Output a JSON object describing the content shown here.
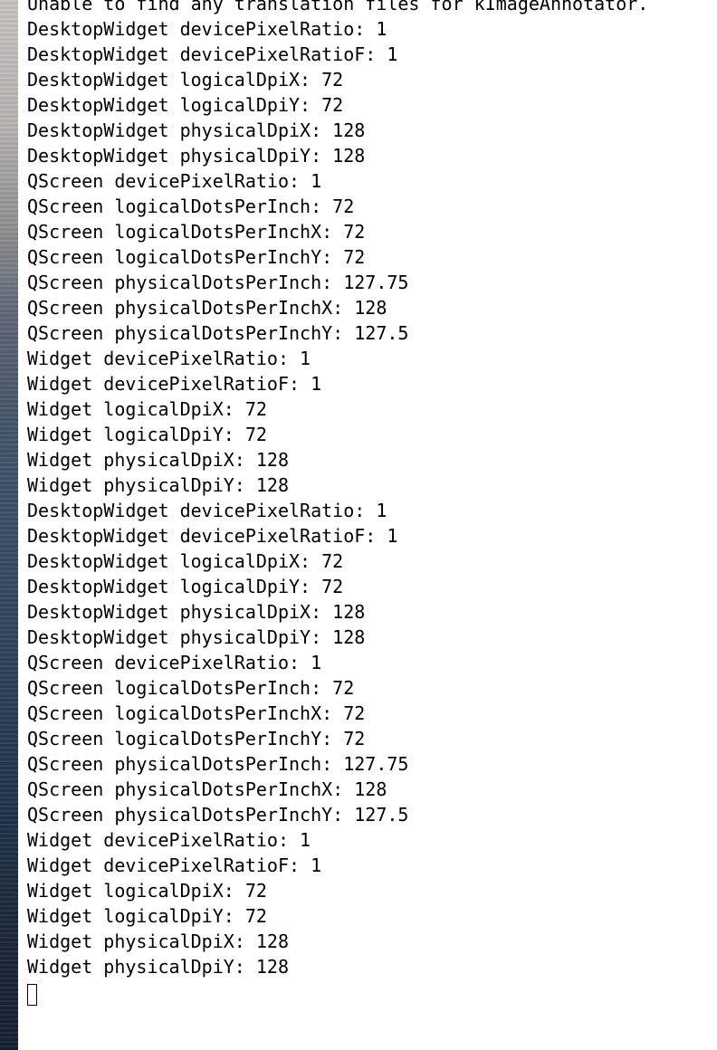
{
  "terminal": {
    "lines": [
      "Unable to find any translation files for kImageAnnotator.",
      "DesktopWidget devicePixelRatio: 1",
      "DesktopWidget devicePixelRatioF: 1",
      "DesktopWidget logicalDpiX: 72",
      "DesktopWidget logicalDpiY: 72",
      "DesktopWidget physicalDpiX: 128",
      "DesktopWidget physicalDpiY: 128",
      "QScreen devicePixelRatio: 1",
      "QScreen logicalDotsPerInch: 72",
      "QScreen logicalDotsPerInchX: 72",
      "QScreen logicalDotsPerInchY: 72",
      "QScreen physicalDotsPerInch: 127.75",
      "QScreen physicalDotsPerInchX: 128",
      "QScreen physicalDotsPerInchY: 127.5",
      "Widget devicePixelRatio: 1",
      "Widget devicePixelRatioF: 1",
      "Widget logicalDpiX: 72",
      "Widget logicalDpiY: 72",
      "Widget physicalDpiX: 128",
      "Widget physicalDpiY: 128",
      "DesktopWidget devicePixelRatio: 1",
      "DesktopWidget devicePixelRatioF: 1",
      "DesktopWidget logicalDpiX: 72",
      "DesktopWidget logicalDpiY: 72",
      "DesktopWidget physicalDpiX: 128",
      "DesktopWidget physicalDpiY: 128",
      "QScreen devicePixelRatio: 1",
      "QScreen logicalDotsPerInch: 72",
      "QScreen logicalDotsPerInchX: 72",
      "QScreen logicalDotsPerInchY: 72",
      "QScreen physicalDotsPerInch: 127.75",
      "QScreen physicalDotsPerInchX: 128",
      "QScreen physicalDotsPerInchY: 127.5",
      "Widget devicePixelRatio: 1",
      "Widget devicePixelRatioF: 1",
      "Widget logicalDpiX: 72",
      "Widget logicalDpiY: 72",
      "Widget physicalDpiX: 128",
      "Widget physicalDpiY: 128"
    ]
  }
}
